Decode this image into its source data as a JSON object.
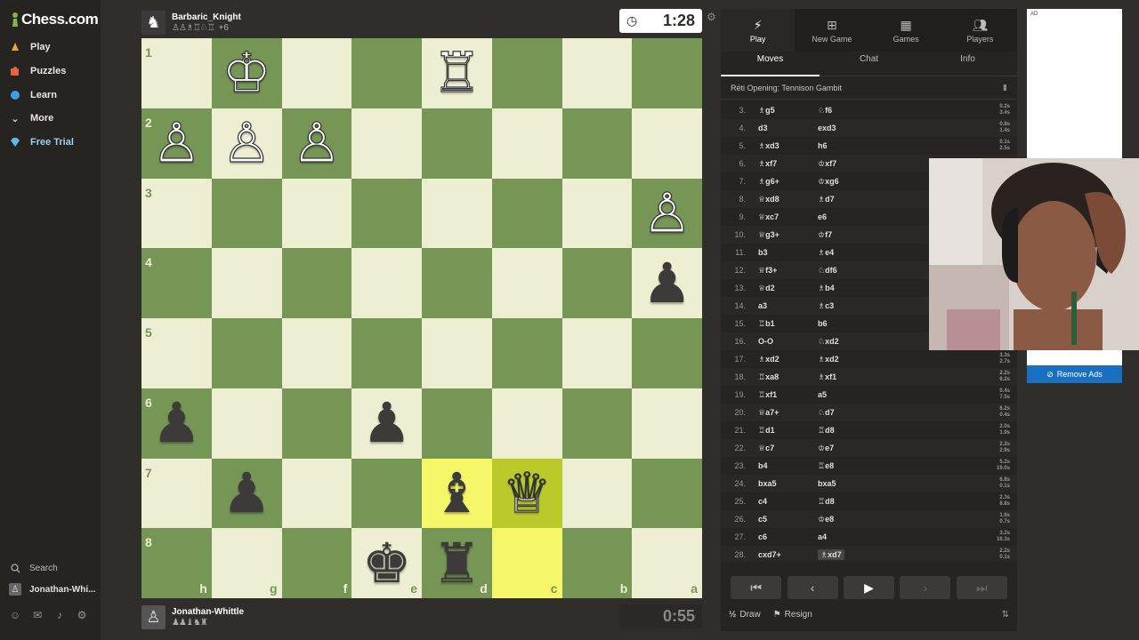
{
  "brand": {
    "name": "Chess.com"
  },
  "sidebar": {
    "items": [
      {
        "label": "Play",
        "icon": "play-pawn-icon"
      },
      {
        "label": "Puzzles",
        "icon": "puzzle-icon"
      },
      {
        "label": "Learn",
        "icon": "learn-icon"
      },
      {
        "label": "More",
        "icon": "chevron-down-icon"
      },
      {
        "label": "Free Trial",
        "icon": "diamond-icon"
      }
    ],
    "search_label": "Search",
    "user_label": "Jonathan-Whi..."
  },
  "top_player": {
    "name": "Barbaric_Knight",
    "captured": "♙♙♗♖♘♖",
    "material": "+6",
    "clock": "1:28"
  },
  "bottom_player": {
    "name": "Jonathan-Whittle",
    "captured": "♟♟♝♞♜",
    "clock": "0:55"
  },
  "board": {
    "ranks": [
      "1",
      "2",
      "3",
      "4",
      "5",
      "6",
      "7",
      "8"
    ],
    "files": [
      "h",
      "g",
      "f",
      "e",
      "d",
      "c",
      "b",
      "a"
    ],
    "highlight": [
      [
        6,
        4
      ],
      [
        6,
        5
      ],
      [
        7,
        5
      ]
    ],
    "pieces": [
      {
        "r": 0,
        "c": 1,
        "p": "♔",
        "side": "white"
      },
      {
        "r": 0,
        "c": 4,
        "p": "♖",
        "side": "white"
      },
      {
        "r": 1,
        "c": 0,
        "p": "♙",
        "side": "white"
      },
      {
        "r": 1,
        "c": 1,
        "p": "♙",
        "side": "white"
      },
      {
        "r": 1,
        "c": 2,
        "p": "♙",
        "side": "white"
      },
      {
        "r": 2,
        "c": 7,
        "p": "♙",
        "side": "white"
      },
      {
        "r": 3,
        "c": 7,
        "p": "♟",
        "side": "black"
      },
      {
        "r": 5,
        "c": 0,
        "p": "♟",
        "side": "black"
      },
      {
        "r": 5,
        "c": 3,
        "p": "♟",
        "side": "black"
      },
      {
        "r": 6,
        "c": 1,
        "p": "♟",
        "side": "black"
      },
      {
        "r": 6,
        "c": 4,
        "p": "♝",
        "side": "black"
      },
      {
        "r": 6,
        "c": 5,
        "p": "♕",
        "side": "white"
      },
      {
        "r": 7,
        "c": 3,
        "p": "♚",
        "side": "black"
      },
      {
        "r": 7,
        "c": 4,
        "p": "♜",
        "side": "black"
      }
    ]
  },
  "panel": {
    "tabs": [
      "Play",
      "New Game",
      "Games",
      "Players"
    ],
    "subtabs": [
      "Moves",
      "Chat",
      "Info"
    ],
    "opening": "Réti Opening: Tennison Gambit",
    "moves": [
      {
        "n": "3.",
        "w": "♗g5",
        "b": "♘f6",
        "t1": "0.2s",
        "t2": "3.4s"
      },
      {
        "n": "4.",
        "w": "d3",
        "b": "exd3",
        "t1": "0.8s",
        "t2": "1.4s"
      },
      {
        "n": "5.",
        "w": "♗xd3",
        "b": "h6",
        "t1": "0.1s",
        "t2": "2.5s"
      },
      {
        "n": "6.",
        "w": "♗xf7",
        "b": "♔xf7",
        "t1": "",
        "": "",
        "t2": ""
      },
      {
        "n": "7.",
        "w": "♗g6+",
        "b": "♔xg6",
        "t1": "",
        "t2": ""
      },
      {
        "n": "8.",
        "w": "♕xd8",
        "b": "♗d7",
        "t1": "",
        "t2": ""
      },
      {
        "n": "9.",
        "w": "♕xc7",
        "b": "e6",
        "t1": "",
        "t2": ""
      },
      {
        "n": "10.",
        "w": "♕g3+",
        "b": "♔f7",
        "t1": "",
        "t2": ""
      },
      {
        "n": "11.",
        "w": "b3",
        "b": "♗e4",
        "t1": "",
        "t2": ""
      },
      {
        "n": "12.",
        "w": "♕f3+",
        "b": "♘df6",
        "t1": "",
        "t2": ""
      },
      {
        "n": "13.",
        "w": "♕d2",
        "b": "♗b4",
        "t1": "",
        "t2": ""
      },
      {
        "n": "14.",
        "w": "a3",
        "b": "♗c3",
        "t1": "",
        "t2": ""
      },
      {
        "n": "15.",
        "w": "♖b1",
        "b": "b6",
        "t1": "",
        "t2": ""
      },
      {
        "n": "16.",
        "w": "O-O",
        "b": "♘xd2",
        "t1": "",
        "t2": ""
      },
      {
        "n": "17.",
        "w": "♗xd2",
        "b": "♗xd2",
        "t1": "3.3s",
        "t2": "2.7s"
      },
      {
        "n": "18.",
        "w": "♖xa8",
        "b": "♗xf1",
        "t1": "2.2s",
        "t2": "6.2s"
      },
      {
        "n": "19.",
        "w": "♖xf1",
        "b": "a5",
        "t1": "0.4s",
        "t2": "7.5s"
      },
      {
        "n": "20.",
        "w": "♕a7+",
        "b": "♘d7",
        "t1": "6.2s",
        "t2": "0.4s"
      },
      {
        "n": "21.",
        "w": "♖d1",
        "b": "♖d8",
        "t1": "2.0s",
        "t2": "1.9s"
      },
      {
        "n": "22.",
        "w": "♕c7",
        "b": "♔e7",
        "t1": "2.2s",
        "t2": "2.9s"
      },
      {
        "n": "23.",
        "w": "b4",
        "b": "♖e8",
        "t1": "5.2s",
        "t2": "19.0s"
      },
      {
        "n": "24.",
        "w": "bxa5",
        "b": "bxa5",
        "t1": "6.8s",
        "t2": "0.1s"
      },
      {
        "n": "25.",
        "w": "c4",
        "b": "♖d8",
        "t1": "2.3s",
        "t2": "8.8s"
      },
      {
        "n": "26.",
        "w": "c5",
        "b": "♔e8",
        "t1": "1.6s",
        "t2": "0.7s"
      },
      {
        "n": "27.",
        "w": "c6",
        "b": "a4",
        "t1": "3.2s",
        "t2": "16.3s"
      },
      {
        "n": "28.",
        "w": "cxd7+",
        "b": "♗xd7",
        "t1": "2.2s",
        "t2": "0.1s"
      }
    ],
    "draw_label": "Draw",
    "resign_label": "Resign"
  },
  "ad": {
    "label": "AD",
    "remove_label": "Remove Ads"
  },
  "colors": {
    "light_square": "#eeeed2",
    "dark_square": "#769656",
    "highlight": "#f6f669",
    "accent": "#1a70c0"
  }
}
